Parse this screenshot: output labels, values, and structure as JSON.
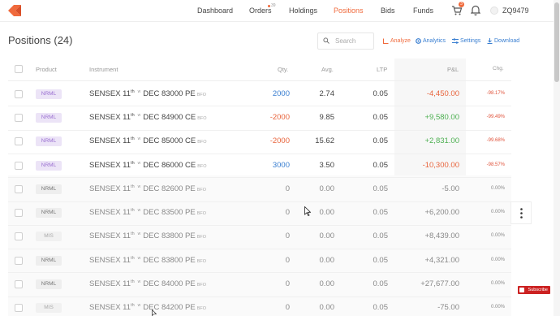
{
  "nav": {
    "items": [
      "Dashboard",
      "Orders",
      "Holdings",
      "Positions",
      "Bids",
      "Funds"
    ],
    "orders_count": "39",
    "cart_count": "3",
    "user_id": "ZQ9479"
  },
  "page": {
    "title": "Positions (24)",
    "search_placeholder": "Search",
    "tools": [
      "Analyze",
      "Analytics",
      "Settings",
      "Download"
    ]
  },
  "table": {
    "headers": [
      "Product",
      "Instrument",
      "Qty.",
      "Avg.",
      "LTP",
      "P&L",
      "Chg."
    ],
    "rows": [
      {
        "product": "NRML",
        "prefix": "SENSEX 11",
        "sup": "th",
        "w": "w",
        "suffix": "DEC 83000 PE",
        "exch": "BFO",
        "qty": "2000",
        "avg": "2.74",
        "ltp": "0.05",
        "pnl": "-4,450.00",
        "chg": "-98.17%"
      },
      {
        "product": "NRML",
        "prefix": "SENSEX 11",
        "sup": "th",
        "w": "w",
        "suffix": "DEC 84900 CE",
        "exch": "BFO",
        "qty": "-2000",
        "avg": "9.85",
        "ltp": "0.05",
        "pnl": "+9,580.00",
        "chg": "-99.49%"
      },
      {
        "product": "NRML",
        "prefix": "SENSEX 11",
        "sup": "th",
        "w": "w",
        "suffix": "DEC 85000 CE",
        "exch": "BFO",
        "qty": "-2000",
        "avg": "15.62",
        "ltp": "0.05",
        "pnl": "+2,831.00",
        "chg": "-99.68%"
      },
      {
        "product": "NRML",
        "prefix": "SENSEX 11",
        "sup": "th",
        "w": "w",
        "suffix": "DEC 86000 CE",
        "exch": "BFO",
        "qty": "3000",
        "avg": "3.50",
        "ltp": "0.05",
        "pnl": "-10,300.00",
        "chg": "-98.57%"
      },
      {
        "product": "NRML",
        "prefix": "SENSEX 11",
        "sup": "th",
        "w": "w",
        "suffix": "DEC 82600 PE",
        "exch": "BFO",
        "qty": "0",
        "avg": "0.00",
        "ltp": "0.05",
        "pnl": "-5.00",
        "chg": "0.00%"
      },
      {
        "product": "NRML",
        "prefix": "SENSEX 11",
        "sup": "th",
        "w": "w",
        "suffix": "DEC 83500 PE",
        "exch": "BFO",
        "qty": "0",
        "avg": "0.00",
        "ltp": "0.05",
        "pnl": "+6,200.00",
        "chg": "0.00%"
      },
      {
        "product": "MIS",
        "prefix": "SENSEX 11",
        "sup": "th",
        "w": "w",
        "suffix": "DEC 83800 PE",
        "exch": "BFO",
        "qty": "0",
        "avg": "0.00",
        "ltp": "0.05",
        "pnl": "+8,439.00",
        "chg": "0.00%"
      },
      {
        "product": "NRML",
        "prefix": "SENSEX 11",
        "sup": "th",
        "w": "w",
        "suffix": "DEC 83800 PE",
        "exch": "BFO",
        "qty": "0",
        "avg": "0.00",
        "ltp": "0.05",
        "pnl": "+4,321.00",
        "chg": "0.00%"
      },
      {
        "product": "NRML",
        "prefix": "SENSEX 11",
        "sup": "th",
        "w": "w",
        "suffix": "DEC 84000 PE",
        "exch": "BFO",
        "qty": "0",
        "avg": "0.00",
        "ltp": "0.05",
        "pnl": "+27,677.00",
        "chg": "0.00%"
      },
      {
        "product": "MIS",
        "prefix": "SENSEX 11",
        "sup": "th",
        "w": "w",
        "suffix": "DEC 84200 PE",
        "exch": "BFO",
        "qty": "0",
        "avg": "0.00",
        "ltp": "0.05",
        "pnl": "-75.00",
        "chg": "0.00%"
      }
    ]
  },
  "overlay": {
    "subscribe_label": "Subscribe"
  },
  "colors": {
    "accent": "#f06a3c",
    "link": "#387ed1",
    "profit": "#4caf50",
    "loss": "#e0533b",
    "product_tag": "#9a6fd1"
  }
}
